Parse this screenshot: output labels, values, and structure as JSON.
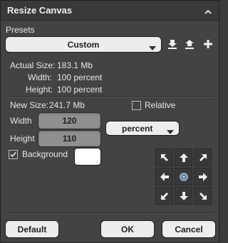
{
  "window": {
    "title": "Resize Canvas"
  },
  "presets": {
    "label": "Presets",
    "selected": "Custom"
  },
  "actual": {
    "size_label": "Actual Size:",
    "size_value": "183.1 Mb",
    "width_label": "Width:",
    "width_value": "100 percent",
    "height_label": "Height:",
    "height_value": "100 percent"
  },
  "new_size": {
    "label": "New Size:",
    "value": "241.7 Mb",
    "relative_label": "Relative",
    "relative_checked": false,
    "width_label": "Width",
    "width_value": "120",
    "height_label": "Height",
    "height_value": "110",
    "unit": "percent",
    "background_label": "Background",
    "background_checked": true,
    "background_color": "#ffffff"
  },
  "anchor": {
    "selected": "center"
  },
  "buttons": {
    "default": "Default",
    "ok": "OK",
    "cancel": "Cancel"
  },
  "colors": {
    "panel": "#434343",
    "field": "#8f8f8f",
    "button": "#ededed"
  }
}
